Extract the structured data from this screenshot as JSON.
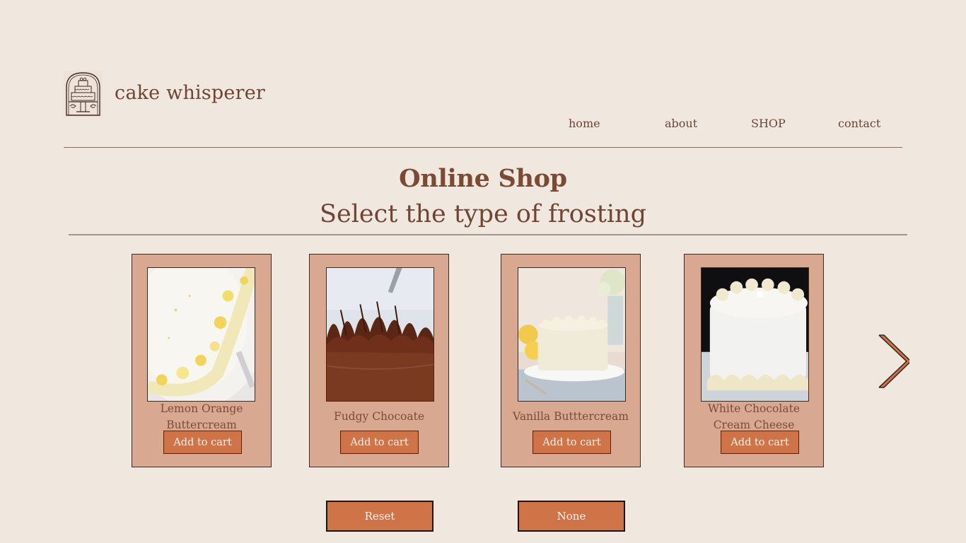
{
  "brand": {
    "name": "cake whisperer",
    "logo_icon": "tiered-cake-arch-icon"
  },
  "nav": {
    "items": [
      {
        "label": "home"
      },
      {
        "label": "about"
      },
      {
        "label": "SHOP"
      },
      {
        "label": "contact"
      }
    ]
  },
  "main": {
    "title": "Online Shop",
    "subtitle": "Select the type of frosting"
  },
  "products": [
    {
      "name_line1": "Lemon Orange",
      "name_line2": "Buttercream",
      "button": "Add to cart",
      "image": "lemon-orange-cake-photo"
    },
    {
      "name_line1": "Fudgy Chocoate",
      "name_line2": "",
      "button": "Add to cart",
      "image": "chocolate-cake-photo"
    },
    {
      "name_line1": "Vanilla Butttercream",
      "name_line2": "",
      "button": "Add to cart",
      "image": "vanilla-cake-photo"
    },
    {
      "name_line1": "White Chocolate",
      "name_line2": "Cream Cheese",
      "button": "Add to cart",
      "image": "white-chocolate-cake-photo"
    }
  ],
  "carousel": {
    "next_icon": "chevron-right-icon"
  },
  "actions": {
    "reset": "Reset",
    "none": "None"
  },
  "colors": {
    "background": "#f0e7df",
    "card": "#d9a890",
    "button": "#cf7449",
    "text": "#6f4433"
  }
}
